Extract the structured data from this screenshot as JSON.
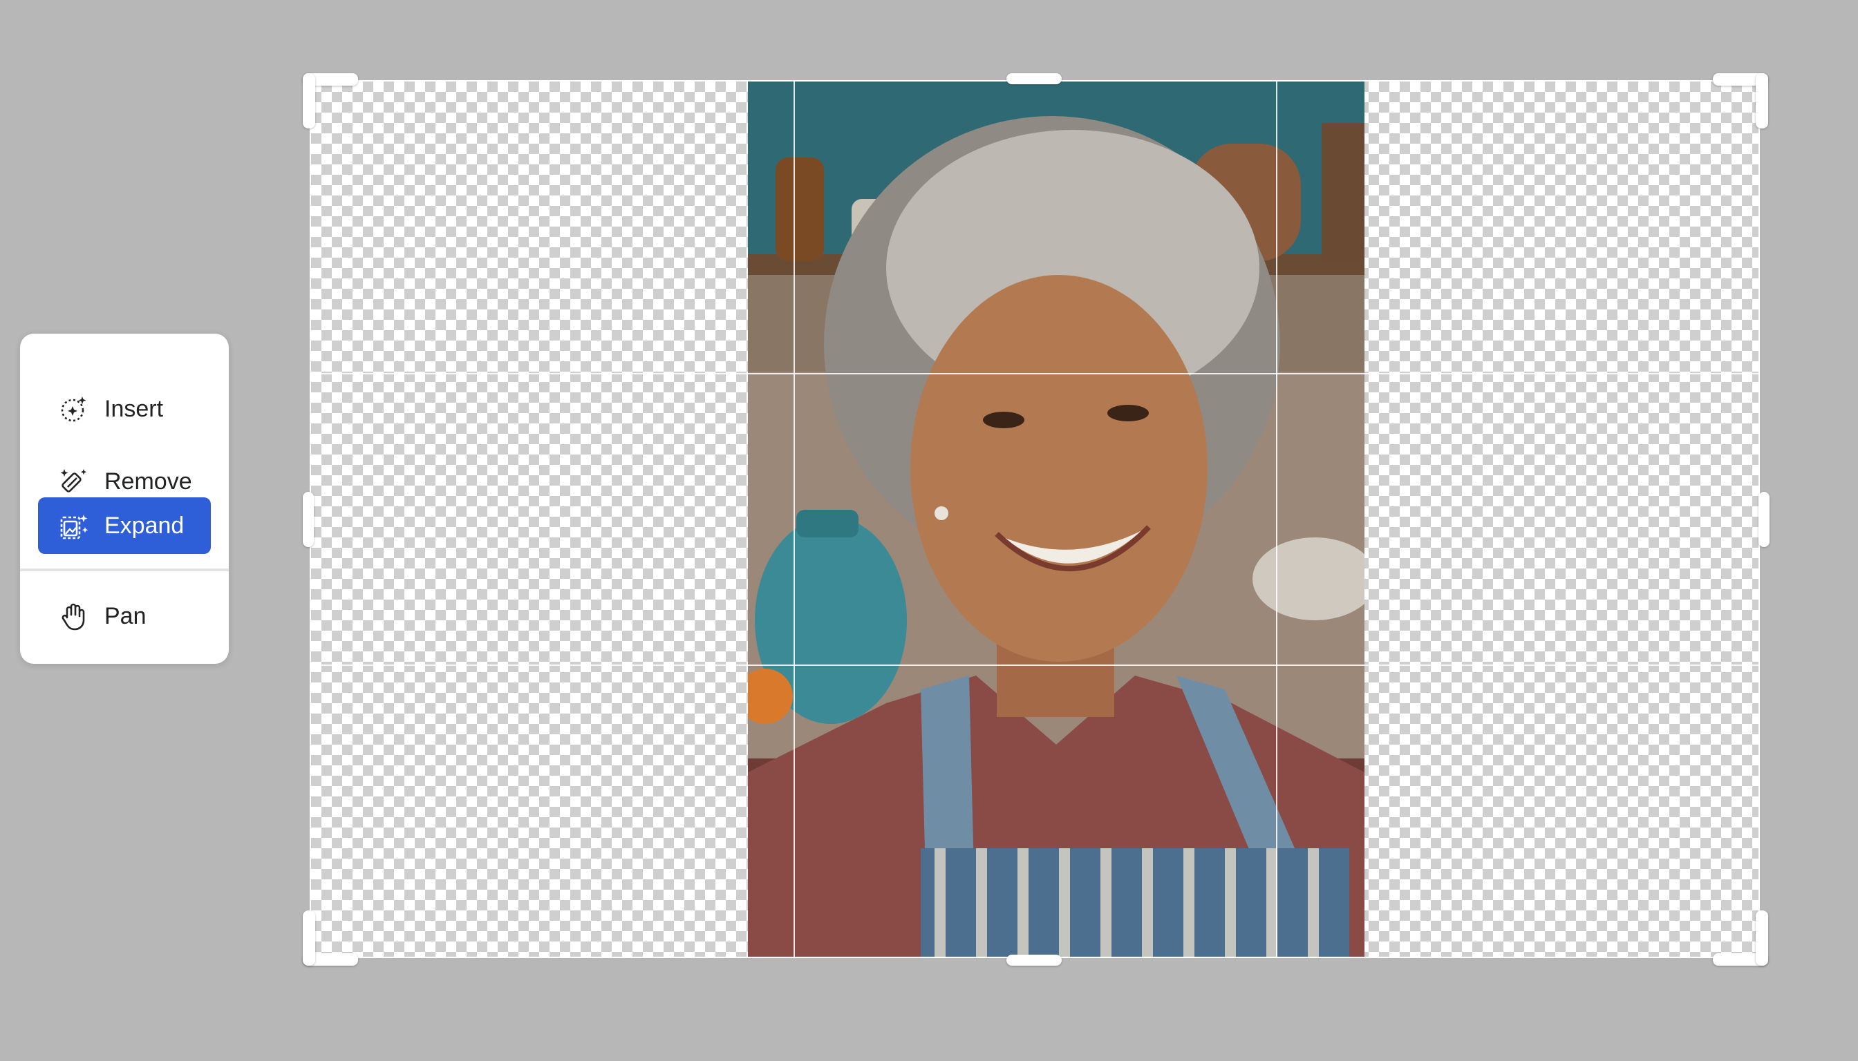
{
  "tools": {
    "items": [
      {
        "label": "Insert",
        "icon": "generative-insert-icon",
        "active": false
      },
      {
        "label": "Remove",
        "icon": "eraser-sparkle-icon",
        "active": false
      },
      {
        "label": "Expand",
        "icon": "expand-image-icon",
        "active": true
      },
      {
        "label": "Pan",
        "icon": "hand-icon",
        "active": false
      }
    ]
  },
  "colors": {
    "canvas_bg": "#b7b7b7",
    "active_accent": "#2f5fd8",
    "panel_bg": "#ffffff"
  }
}
